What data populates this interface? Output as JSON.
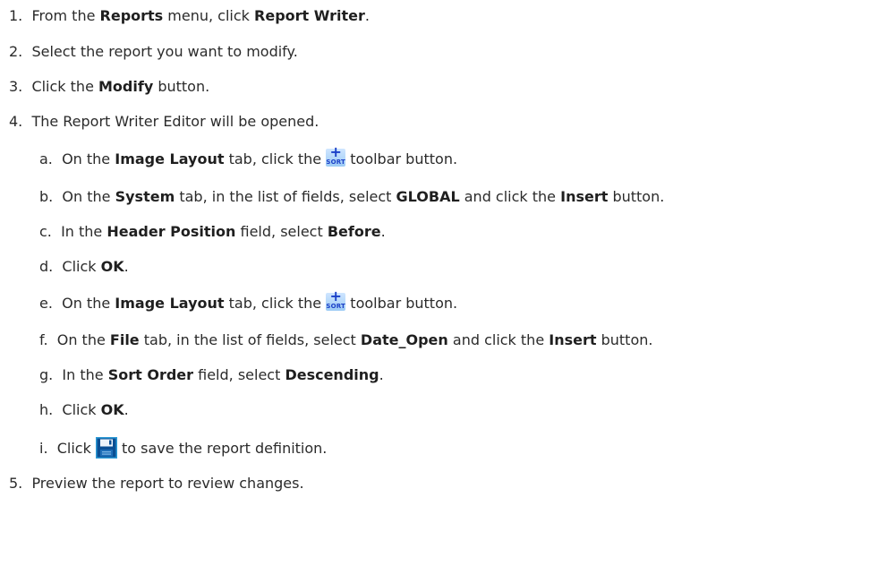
{
  "steps": [
    {
      "num": "1.",
      "pre": "From the ",
      "b1": "Reports",
      "mid": " menu, click ",
      "b2": "Report Writer",
      "post": "."
    },
    {
      "num": "2.",
      "text": "Select the report you want to modify."
    },
    {
      "num": "3.",
      "pre": "Click the ",
      "b1": "Modify",
      "post": " button."
    },
    {
      "num": "4.",
      "text": "The Report Writer Editor will be opened."
    },
    {
      "num": "5.",
      "text": "Preview the report to review changes."
    }
  ],
  "substeps": [
    {
      "letter": "a.",
      "pre": "On the ",
      "b1": "Image Layout",
      "mid": " tab, click the ",
      "post": " toolbar button."
    },
    {
      "letter": "b.",
      "pre": "On the ",
      "b1": "System",
      "mid": " tab, in the list of fields, select ",
      "b2": "GLOBAL",
      "mid2": " and click the ",
      "b3": "Insert",
      "post": " button."
    },
    {
      "letter": "c.",
      "pre": "In the ",
      "b1": "Header Position",
      "mid": " field, select ",
      "b2": "Before",
      "post": "."
    },
    {
      "letter": "d.",
      "pre": "Click ",
      "b1": "OK",
      "post": "."
    },
    {
      "letter": "e.",
      "pre": "On the ",
      "b1": "Image Layout",
      "mid": " tab, click the ",
      "post": " toolbar button."
    },
    {
      "letter": "f.",
      "pre": "On the ",
      "b1": "File",
      "mid": " tab, in the list of fields, select ",
      "b2": "Date_Open",
      "mid2": " and click the ",
      "b3": "Insert",
      "post": " button."
    },
    {
      "letter": "g.",
      "pre": "In the ",
      "b1": "Sort Order",
      "mid": " field, select ",
      "b2": "Descending",
      "post": "."
    },
    {
      "letter": "h.",
      "pre": "Click ",
      "b1": "OK",
      "post": "."
    },
    {
      "letter": "i.",
      "pre": "Click ",
      "post": " to save the report definition."
    }
  ],
  "icons": {
    "sort_plus": "+",
    "sort_word": "SORT",
    "sort_icon_name": "sort-icon",
    "save_icon_name": "save-disk-icon"
  }
}
